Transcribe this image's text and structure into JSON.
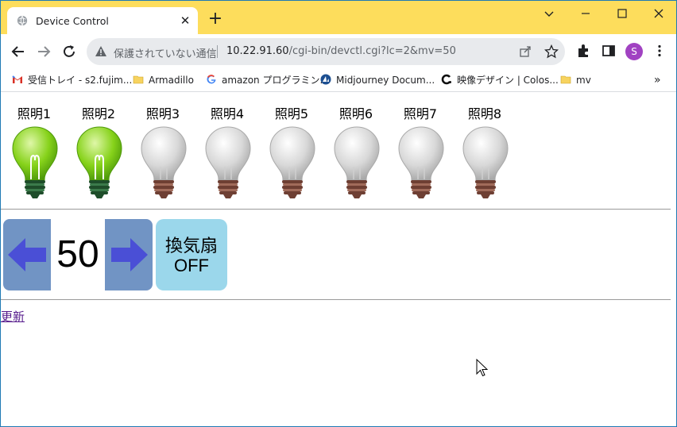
{
  "browser": {
    "tab_title": "Device Control",
    "security_text": "保護されていない通信",
    "url_host": "10.22.91.60",
    "url_path": "/cgi-bin/devctl.cgi?lc=2&mv=50",
    "avatar_letter": "S",
    "bookmarks": [
      {
        "label": "受信トレイ - s2.fujim...",
        "icon": "gmail-icon"
      },
      {
        "label": "Armadillo",
        "icon": "folder-icon"
      },
      {
        "label": "amazon プログラミン...",
        "icon": "google-icon"
      },
      {
        "label": "Midjourney Docum...",
        "icon": "midjourney-icon"
      },
      {
        "label": "映像デザイン | Colos...",
        "icon": "colos-icon"
      },
      {
        "label": "mv",
        "icon": "folder-icon"
      }
    ],
    "accent_color": "#fddd5c"
  },
  "lights": [
    {
      "label": "照明1",
      "on": true
    },
    {
      "label": "照明2",
      "on": true
    },
    {
      "label": "照明3",
      "on": false
    },
    {
      "label": "照明4",
      "on": false
    },
    {
      "label": "照明5",
      "on": false
    },
    {
      "label": "照明6",
      "on": false
    },
    {
      "label": "照明7",
      "on": false
    },
    {
      "label": "照明8",
      "on": false
    }
  ],
  "level": {
    "value": "50"
  },
  "fan": {
    "line1": "換気扇",
    "line2": "OFF"
  },
  "refresh_label": "更新"
}
